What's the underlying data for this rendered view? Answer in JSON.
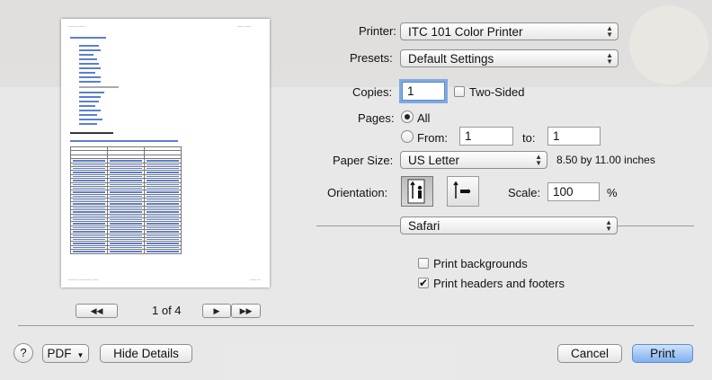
{
  "printer": {
    "label": "Printer:",
    "value": "ITC 101 Color Printer"
  },
  "presets": {
    "label": "Presets:",
    "value": "Default Settings"
  },
  "copies": {
    "label": "Copies:",
    "value": "1",
    "two_sided_label": "Two-Sided",
    "two_sided_checked": false
  },
  "pages": {
    "label": "Pages:",
    "all_label": "All",
    "from_label": "From:",
    "from_value": "1",
    "to_label": "to:",
    "to_value": "1",
    "selected": "all"
  },
  "paper_size": {
    "label": "Paper Size:",
    "value": "US Letter",
    "dimensions": "8.50 by 11.00 inches"
  },
  "orientation": {
    "label": "Orientation:",
    "selected": "portrait",
    "icons": [
      "portrait-icon",
      "landscape-icon"
    ]
  },
  "scale": {
    "label": "Scale:",
    "value": "100",
    "unit": "%"
  },
  "section": {
    "value": "Safari"
  },
  "options": {
    "print_backgrounds": {
      "label": "Print backgrounds",
      "checked": false
    },
    "print_headers_footers": {
      "label": "Print headers and footers",
      "checked": true
    }
  },
  "pager": {
    "text": "1 of 4"
  },
  "bottom": {
    "help": "?",
    "pdf": "PDF",
    "hide_details": "Hide Details",
    "cancel": "Cancel",
    "print": "Print"
  },
  "colors": {
    "accent": "#7fb0ee",
    "sheet": "#ececec",
    "link": "#5b7fd0"
  }
}
